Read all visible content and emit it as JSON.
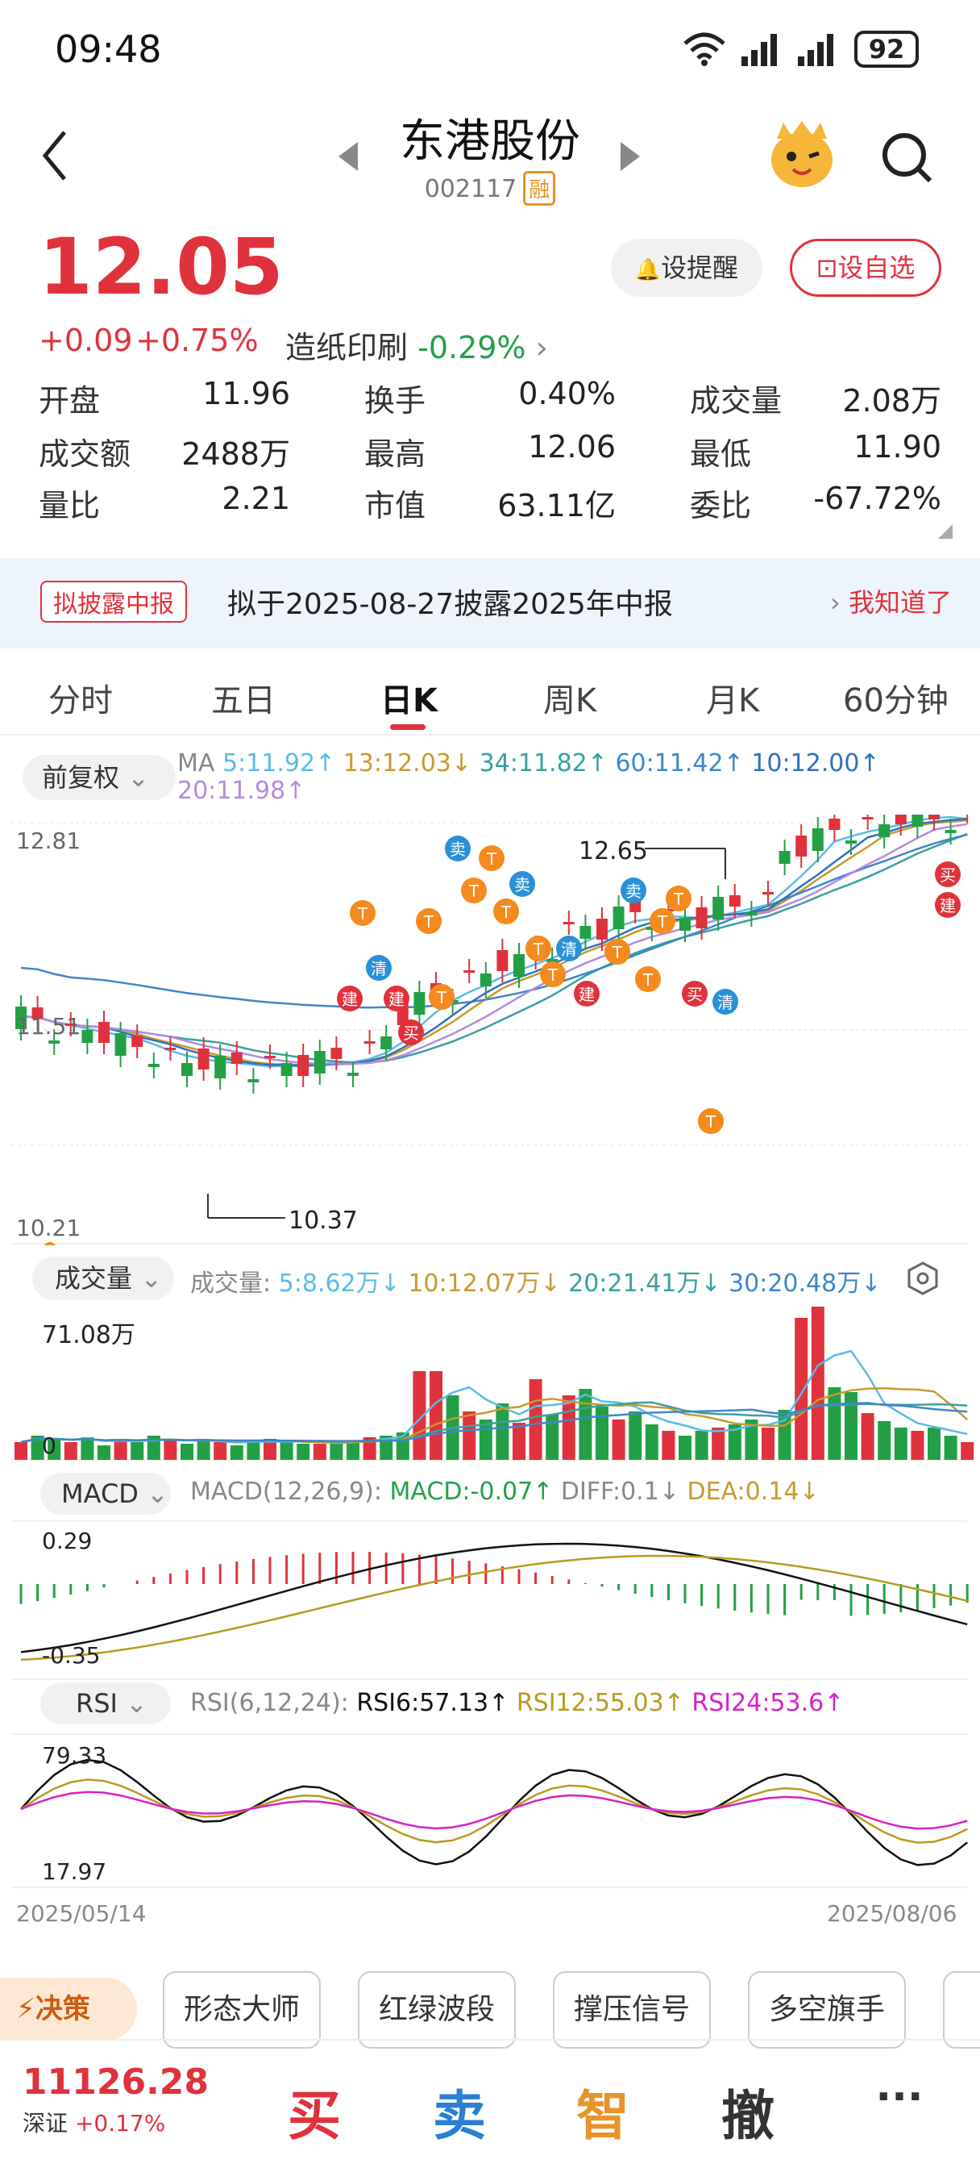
{
  "status_bar": {
    "time": "09:48",
    "battery": "92"
  },
  "header": {
    "title": "东港股份",
    "code": "002117",
    "margin_badge": "融"
  },
  "quote": {
    "price": "12.05",
    "change": "+0.09",
    "change_pct": "+0.75%",
    "sector": "造纸印刷",
    "sector_pct": "-0.29%",
    "remind_label": "设提醒",
    "watch_label": "设自选"
  },
  "stats": [
    {
      "label": "开盘",
      "value": "11.96",
      "color": "normal"
    },
    {
      "label": "换手",
      "value": "0.40%",
      "color": "normal"
    },
    {
      "label": "成交量",
      "value": "2.08万",
      "color": "normal"
    },
    {
      "label": "成交额",
      "value": "2488万",
      "color": "normal"
    },
    {
      "label": "最高",
      "value": "12.06",
      "color": "red"
    },
    {
      "label": "最低",
      "value": "11.90",
      "color": "green"
    },
    {
      "label": "量比",
      "value": "2.21",
      "color": "normal"
    },
    {
      "label": "市值",
      "value": "63.11亿",
      "color": "normal"
    },
    {
      "label": "委比",
      "value": "-67.72%",
      "color": "green"
    }
  ],
  "notice": {
    "tag": "拟披露中报",
    "text": "拟于2025-08-27披露2025年中报",
    "action": "我知道了"
  },
  "tabs": [
    "分时",
    "五日",
    "日K",
    "周K",
    "月K",
    "60分钟"
  ],
  "active_tab": "日K",
  "kline": {
    "adjust_label": "前复权",
    "ma_title": "MA",
    "ma": [
      {
        "text": "5:11.92↑",
        "color": "#5bbbe6"
      },
      {
        "text": "13:12.03↓",
        "color": "#c89a2e"
      },
      {
        "text": "34:11.82↑",
        "color": "#3aa0a0"
      },
      {
        "text": "60:11.42↑",
        "color": "#3f86c9"
      },
      {
        "text": "10:12.00↑",
        "color": "#3070c0"
      },
      {
        "text": "20:11.98↑",
        "color": "#b48be0"
      }
    ],
    "y_high": "12.81",
    "y_mid": "11.51",
    "y_low": "10.21",
    "peak_label": "12.65",
    "trough_label": "10.37"
  },
  "volume": {
    "label": "成交量",
    "title": "成交量:",
    "items": [
      {
        "text": "5:8.62万↓",
        "color": "#5bbbe6"
      },
      {
        "text": "10:12.07万↓",
        "color": "#c89a2e"
      },
      {
        "text": "20:21.41万↓",
        "color": "#3aa0a0"
      },
      {
        "text": "30:20.48万↓",
        "color": "#3f86c9"
      }
    ],
    "max_label": "71.08万",
    "zero_label": "0"
  },
  "macd": {
    "label": "MACD",
    "params": "MACD(12,26,9):",
    "macd_val": "MACD:-0.07↑",
    "diff_val": "DIFF:0.1↓",
    "dea_val": "DEA:0.14↓",
    "top": "0.29",
    "bottom": "-0.35"
  },
  "rsi": {
    "label": "RSI",
    "params": "RSI(6,12,24):",
    "rsi6": "RSI6:57.13↑",
    "rsi12": "RSI12:55.03↑",
    "rsi24": "RSI24:53.6↑",
    "top": "79.33",
    "bottom": "17.97"
  },
  "dates": {
    "start": "2025/05/14",
    "end": "2025/08/06"
  },
  "tools": {
    "decision": "决策",
    "buttons": [
      "形态大师",
      "红绿波段",
      "撑压信号",
      "多空旗手"
    ]
  },
  "footer": {
    "index_value": "11126.28",
    "index_name": "深证",
    "index_pct": "+0.17%",
    "buy": "买",
    "sell": "卖",
    "smart": "智",
    "cancel": "撤",
    "more": "···"
  },
  "colors": {
    "up": "#e0323c",
    "down": "#23a046",
    "accent": "#e8942a"
  }
}
